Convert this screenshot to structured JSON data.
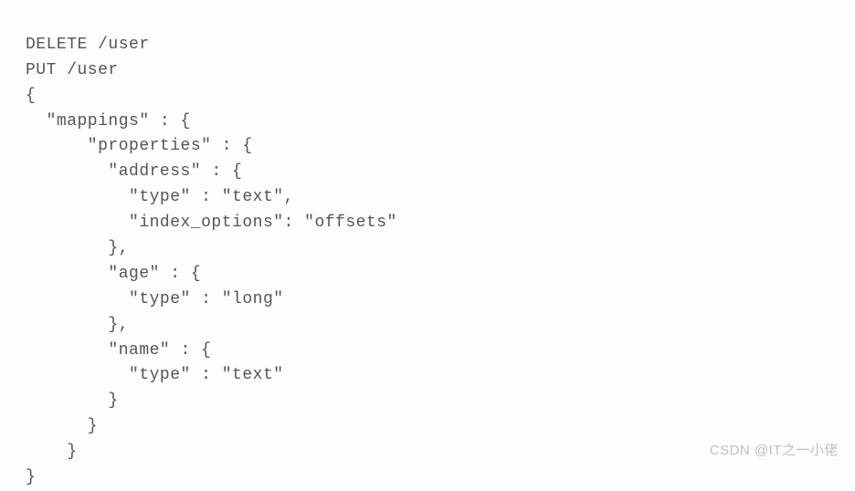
{
  "code": {
    "line1": "DELETE /user",
    "line2": "PUT /user",
    "line3": "{",
    "line4": "  \"mappings\" : {",
    "line5": "      \"properties\" : {",
    "line6": "        \"address\" : {",
    "line7": "          \"type\" : \"text\",",
    "line8": "          \"index_options\": \"offsets\"",
    "line9": "        },",
    "line10": "        \"age\" : {",
    "line11": "          \"type\" : \"long\"",
    "line12": "        },",
    "line13": "        \"name\" : {",
    "line14": "          \"type\" : \"text\"",
    "line15": "        }",
    "line16": "      }",
    "line17": "    }",
    "line18": "}"
  },
  "watermark": "CSDN @IT之一小佬",
  "request_data": {
    "delete": {
      "method": "DELETE",
      "path": "/user"
    },
    "put": {
      "method": "PUT",
      "path": "/user",
      "body": {
        "mappings": {
          "properties": {
            "address": {
              "type": "text",
              "index_options": "offsets"
            },
            "age": {
              "type": "long"
            },
            "name": {
              "type": "text"
            }
          }
        }
      }
    }
  }
}
